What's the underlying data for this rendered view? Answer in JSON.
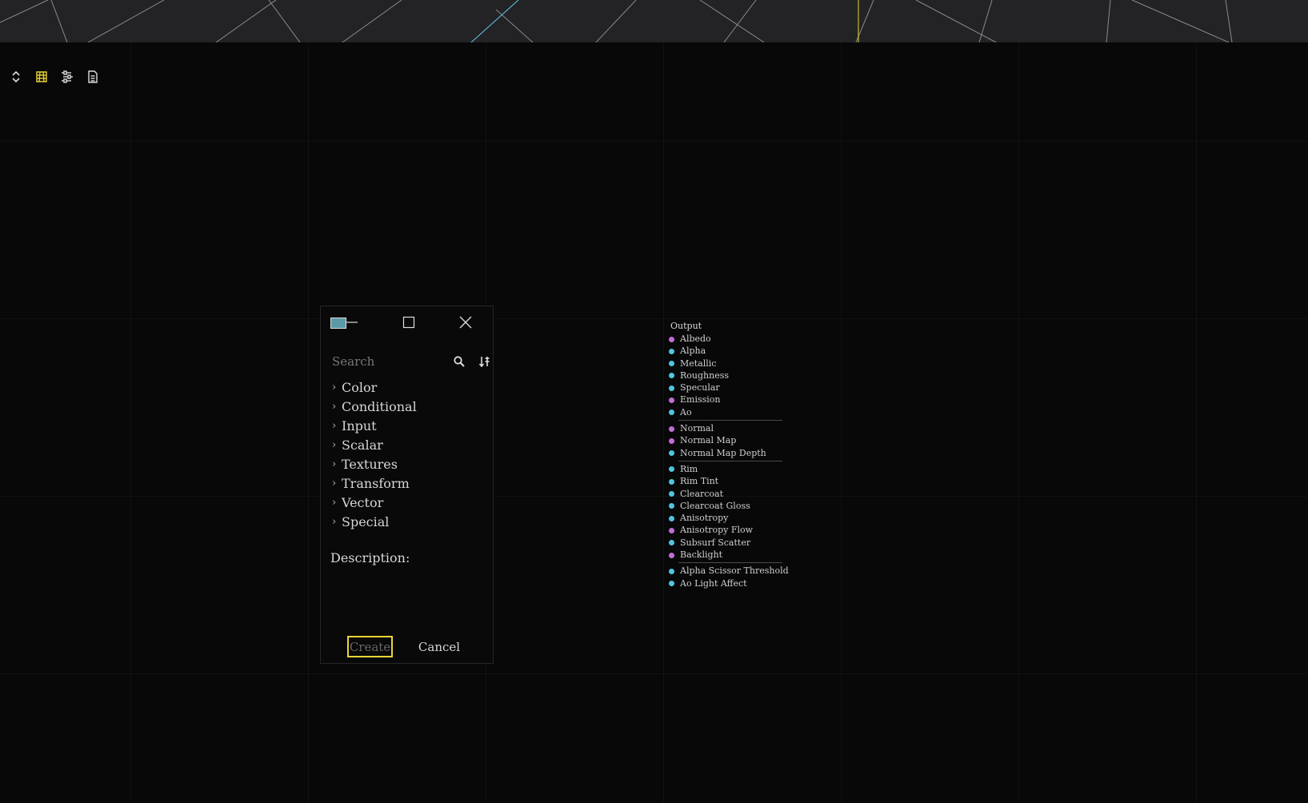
{
  "colors": {
    "accent": "#e9d534",
    "viewport_bg": "#232325",
    "graph_bg": "#080808",
    "port_vector": "#c56bd8",
    "port_scalar": "#4fc6e0"
  },
  "toolbar": {
    "items": [
      {
        "name": "expand-collapse-icon"
      },
      {
        "name": "grid-snap-icon",
        "active": true
      },
      {
        "name": "arrange-icon"
      },
      {
        "name": "document-icon"
      }
    ]
  },
  "dialog": {
    "search_placeholder": "Search",
    "categories": [
      {
        "label": "Color"
      },
      {
        "label": "Conditional"
      },
      {
        "label": "Input"
      },
      {
        "label": "Scalar"
      },
      {
        "label": "Textures"
      },
      {
        "label": "Transform"
      },
      {
        "label": "Vector"
      },
      {
        "label": "Special"
      }
    ],
    "description_label": "Description:",
    "create_label": "Create",
    "cancel_label": "Cancel"
  },
  "output_node": {
    "title": "Output",
    "groups": [
      [
        {
          "label": "Albedo",
          "type": "vector"
        },
        {
          "label": "Alpha",
          "type": "scalar"
        },
        {
          "label": "Metallic",
          "type": "scalar"
        },
        {
          "label": "Roughness",
          "type": "scalar"
        },
        {
          "label": "Specular",
          "type": "scalar"
        },
        {
          "label": "Emission",
          "type": "vector"
        },
        {
          "label": "Ao",
          "type": "scalar"
        }
      ],
      [
        {
          "label": "Normal",
          "type": "vector"
        },
        {
          "label": "Normal Map",
          "type": "vector"
        },
        {
          "label": "Normal Map Depth",
          "type": "scalar"
        }
      ],
      [
        {
          "label": "Rim",
          "type": "scalar"
        },
        {
          "label": "Rim Tint",
          "type": "scalar"
        },
        {
          "label": "Clearcoat",
          "type": "scalar"
        },
        {
          "label": "Clearcoat Gloss",
          "type": "scalar"
        },
        {
          "label": "Anisotropy",
          "type": "scalar"
        },
        {
          "label": "Anisotropy Flow",
          "type": "vector"
        },
        {
          "label": "Subsurf Scatter",
          "type": "scalar"
        },
        {
          "label": "Backlight",
          "type": "vector"
        }
      ],
      [
        {
          "label": "Alpha Scissor Threshold",
          "type": "scalar"
        },
        {
          "label": "Ao Light Affect",
          "type": "scalar"
        }
      ]
    ]
  }
}
